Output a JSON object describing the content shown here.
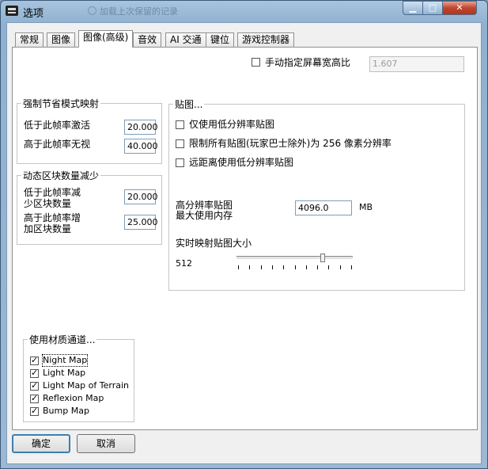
{
  "window": {
    "title": "选项",
    "background_hint": "加载上次保留的记录"
  },
  "tabs": [
    {
      "label": "常规"
    },
    {
      "label": "图像"
    },
    {
      "label": "图像(高级)"
    },
    {
      "label": "音效"
    },
    {
      "label": "AI 交通"
    },
    {
      "label": "键位"
    },
    {
      "label": "游戏控制器"
    }
  ],
  "aspect": {
    "label": "手动指定屏幕宽高比",
    "checked": false,
    "value": "1.607"
  },
  "lod_group": {
    "title": "强制节省模式映射",
    "rows": [
      {
        "label": "低于此帧率激活",
        "value": "20.000"
      },
      {
        "label": "高于此帧率无视",
        "value": "40.000"
      }
    ]
  },
  "blocks_group": {
    "title": "动态区块数量减少",
    "rows": [
      {
        "label_line1": "低于此帧率减",
        "label_line2": "少区块数量",
        "value": "20.000"
      },
      {
        "label_line1": "高于此帧率增",
        "label_line2": "加区块数量",
        "value": "25.000"
      }
    ]
  },
  "texture_group": {
    "title": "贴图...",
    "options": [
      {
        "label": "仅使用低分辨率贴图",
        "checked": false
      },
      {
        "label": "限制所有贴图(玩家巴士除外)为 256 像素分辨率",
        "checked": false
      },
      {
        "label": "远距离使用低分辨率贴图",
        "checked": false
      }
    ],
    "memory_label_line1": "高分辨率贴图",
    "memory_label_line2": "最大使用内存",
    "memory_value": "4096.0",
    "memory_unit": "MB",
    "realtime_label": "实时映射贴图大小",
    "realtime_value": "512",
    "slider_fraction": 0.75
  },
  "material_group": {
    "title": "使用材质通道...",
    "items": [
      {
        "label": "Night Map",
        "checked": true
      },
      {
        "label": "Light Map",
        "checked": true
      },
      {
        "label": "Light Map of Terrain",
        "checked": true
      },
      {
        "label": "Reflexion Map",
        "checked": true
      },
      {
        "label": "Bump Map",
        "checked": true
      }
    ]
  },
  "buttons": {
    "ok": "确定",
    "cancel": "取消"
  }
}
